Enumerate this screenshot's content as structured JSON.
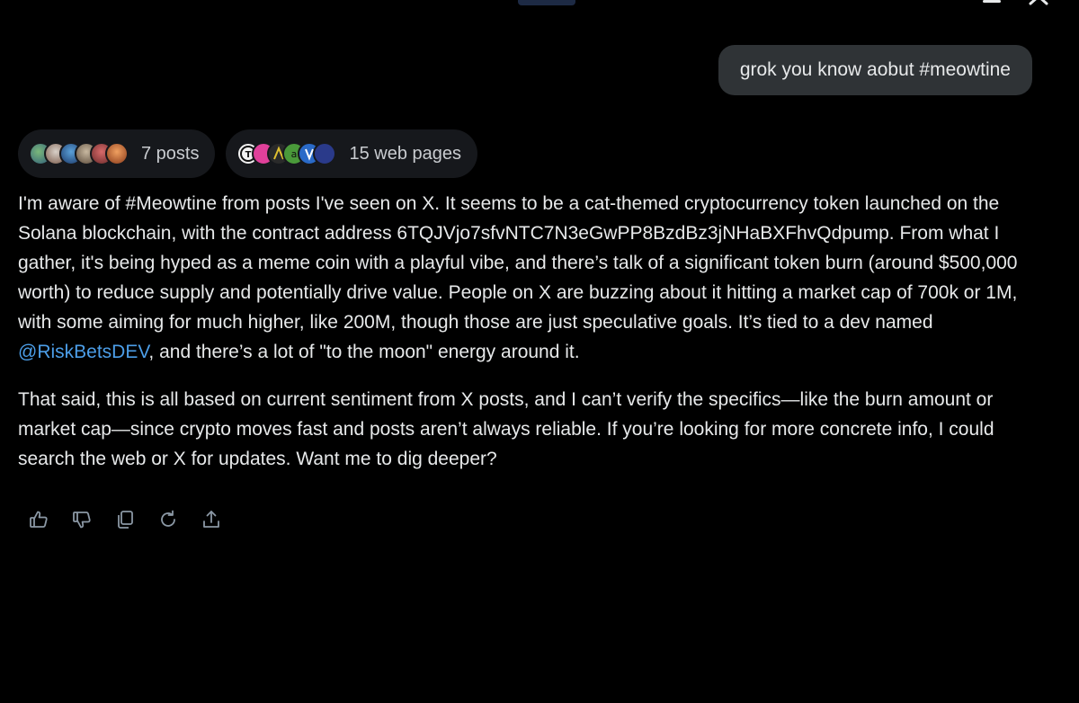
{
  "conversation": {
    "user_message": "grok you know aobut #meowtine"
  },
  "sources": {
    "posts_label": "7 posts",
    "web_label": "15 web pages"
  },
  "response": {
    "p1_part1": "I'm aware of #Meowtine from posts I've seen on X. It seems to be a cat-themed cryptocurrency token launched on the Solana blockchain, with the contract address 6TQJVjo7sfvNTC7N3eGwPP8BzdBz3jNHaBXFhvQdpump. From what I gather, it's being hyped as a meme coin with a playful vibe, and there’s talk of a significant token burn (around $500,000 worth) to reduce supply and potentially drive value. People on X are buzzing about it hitting a market cap of 700k or 1M, with some aiming for much higher, like 200M, though those are just speculative goals. It’s tied to a dev named ",
    "mention": "@RiskBetsDEV",
    "p1_part2": ", and there’s a lot of \"to the moon\" energy around it.",
    "p2": "That said, this is all based on current sentiment from X posts, and I can’t verify the specifics—like the burn amount or market cap—since crypto moves fast and posts aren’t always reliable. If you’re looking for more concrete info, I could search the web or X for updates. Want me to dig deeper?"
  },
  "colors": {
    "background": "#000000",
    "bubble": "#2f3336",
    "pill": "#16181c",
    "link": "#4c9ee8",
    "icon": "#8b98a5"
  },
  "icons": {
    "actions": [
      "thumbs-up-icon",
      "thumbs-down-icon",
      "copy-icon",
      "regenerate-icon",
      "share-icon"
    ]
  }
}
